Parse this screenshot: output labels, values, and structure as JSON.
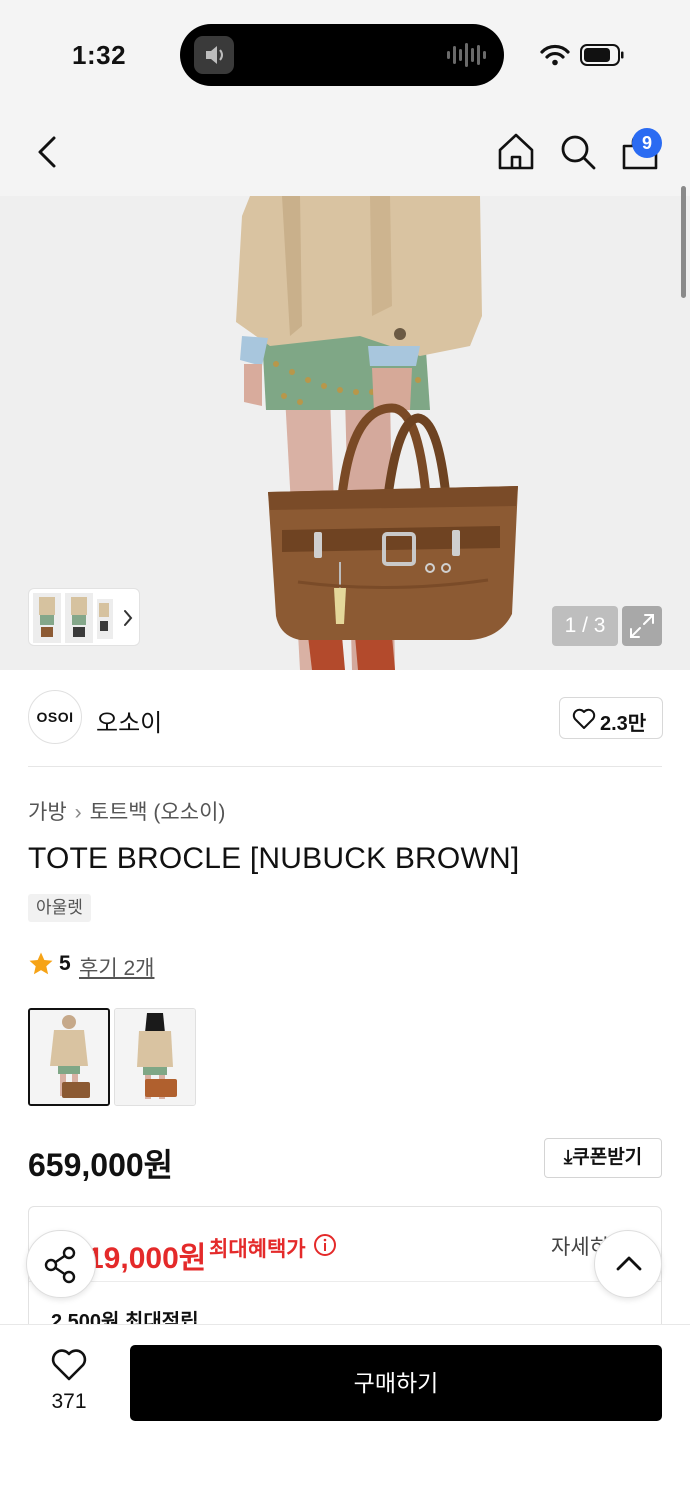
{
  "status_bar": {
    "time": "1:32"
  },
  "header": {
    "cart_count": "9"
  },
  "hero": {
    "pager": "1 / 3"
  },
  "brand": {
    "logo_text": "OSOI",
    "name": "오소이",
    "likes": "2.3만"
  },
  "breadcrumb": {
    "category": "가방",
    "subcategory": "토트백 (오소이)"
  },
  "product": {
    "title": "TOTE BROCLE [NUBUCK BROWN]",
    "tag": "아울렛",
    "rating": "5",
    "review_link": "후기 2개",
    "price": "659,000원",
    "coupon_label": "쿠폰받기"
  },
  "benefit": {
    "max_price": "19,000원",
    "max_label": "최대혜택가",
    "detail_label": "자세히",
    "points": "2,500원 최대적립"
  },
  "bottom_bar": {
    "wish_count": "371",
    "buy_label": "구매하기"
  },
  "colors": {
    "accent": "#2a6bf2",
    "sale_red": "#e42a2a",
    "buy_black": "#000000"
  }
}
